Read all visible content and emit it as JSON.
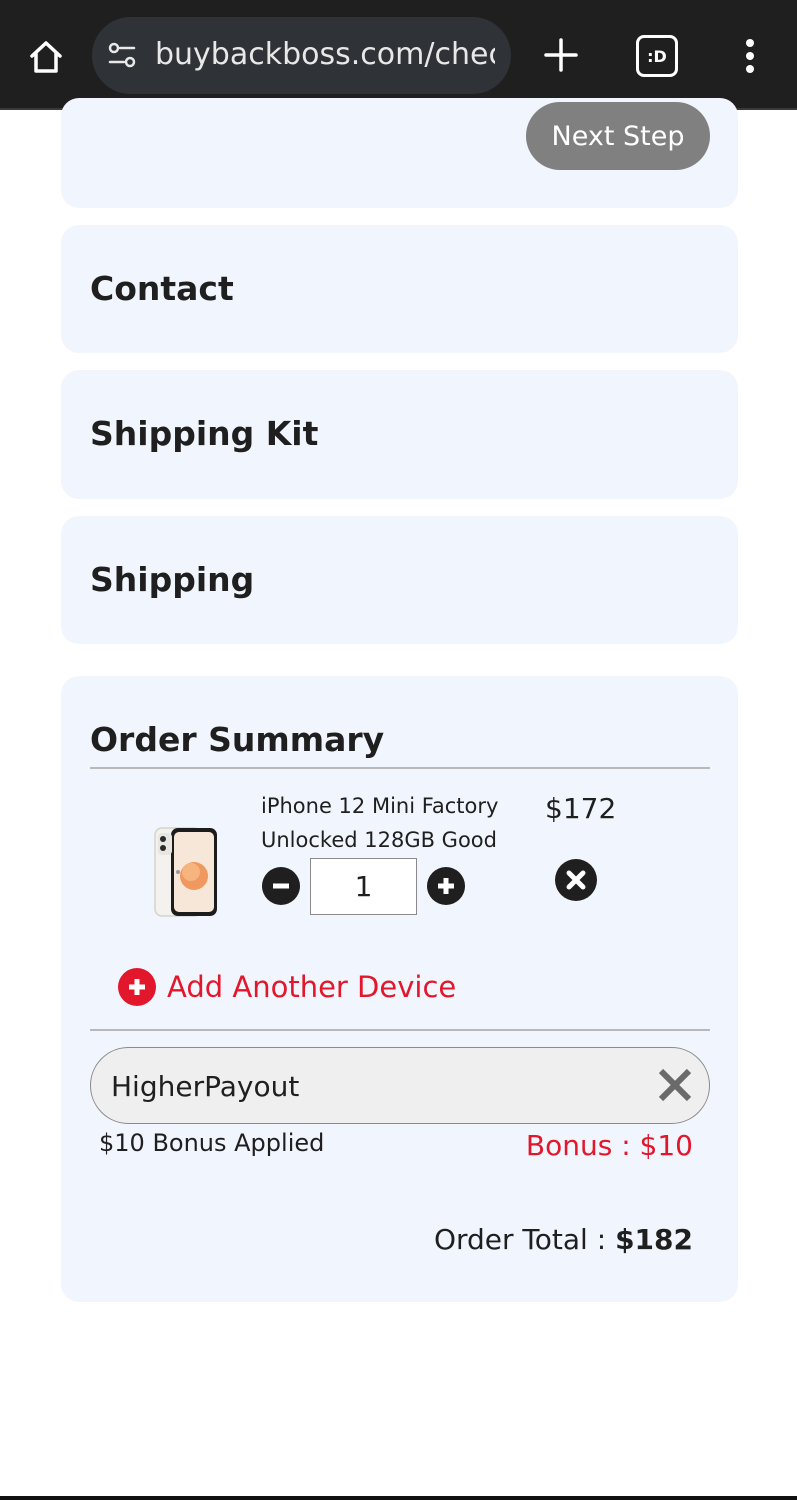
{
  "browser": {
    "url": "buybackboss.com/checkout",
    "tabs_label": ":D"
  },
  "step_card": {
    "next_step_label": "Next Step"
  },
  "sections": {
    "contact": "Contact",
    "shipping_kit": "Shipping Kit",
    "shipping": "Shipping"
  },
  "summary": {
    "title": "Order Summary",
    "item": {
      "name": "iPhone 12 Mini Factory Unlocked 128GB Good",
      "price": "$172",
      "quantity": "1"
    },
    "add_device_label": "Add Another Device",
    "promo_code": "HigherPayout",
    "bonus_applied": "$10 Bonus Applied",
    "bonus_amount": "Bonus : $10",
    "order_total_label": "Order Total : ",
    "order_total_value": "$182"
  },
  "colors": {
    "accent_red": "#e3172b",
    "card_bg": "#f1f5fd",
    "button_gray": "#808080"
  }
}
